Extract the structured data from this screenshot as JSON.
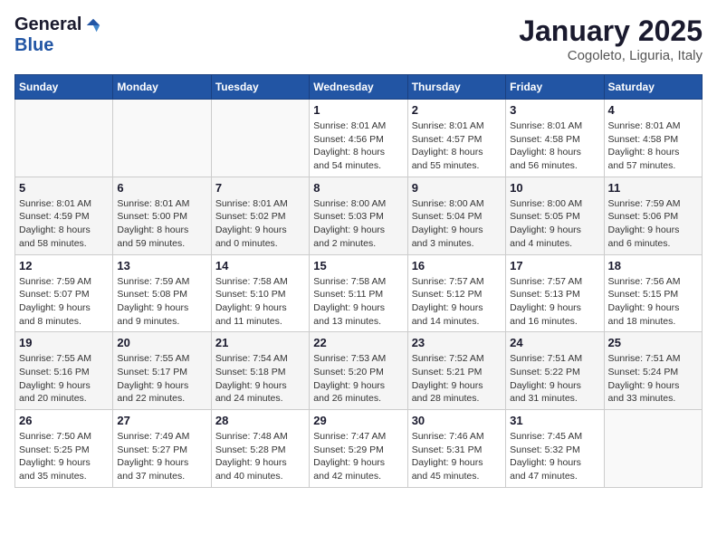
{
  "logo": {
    "general": "General",
    "blue": "Blue"
  },
  "header": {
    "month": "January 2025",
    "location": "Cogoleto, Liguria, Italy"
  },
  "weekdays": [
    "Sunday",
    "Monday",
    "Tuesday",
    "Wednesday",
    "Thursday",
    "Friday",
    "Saturday"
  ],
  "weeks": [
    [
      {
        "day": "",
        "info": ""
      },
      {
        "day": "",
        "info": ""
      },
      {
        "day": "",
        "info": ""
      },
      {
        "day": "1",
        "info": "Sunrise: 8:01 AM\nSunset: 4:56 PM\nDaylight: 8 hours\nand 54 minutes."
      },
      {
        "day": "2",
        "info": "Sunrise: 8:01 AM\nSunset: 4:57 PM\nDaylight: 8 hours\nand 55 minutes."
      },
      {
        "day": "3",
        "info": "Sunrise: 8:01 AM\nSunset: 4:58 PM\nDaylight: 8 hours\nand 56 minutes."
      },
      {
        "day": "4",
        "info": "Sunrise: 8:01 AM\nSunset: 4:58 PM\nDaylight: 8 hours\nand 57 minutes."
      }
    ],
    [
      {
        "day": "5",
        "info": "Sunrise: 8:01 AM\nSunset: 4:59 PM\nDaylight: 8 hours\nand 58 minutes."
      },
      {
        "day": "6",
        "info": "Sunrise: 8:01 AM\nSunset: 5:00 PM\nDaylight: 8 hours\nand 59 minutes."
      },
      {
        "day": "7",
        "info": "Sunrise: 8:01 AM\nSunset: 5:02 PM\nDaylight: 9 hours\nand 0 minutes."
      },
      {
        "day": "8",
        "info": "Sunrise: 8:00 AM\nSunset: 5:03 PM\nDaylight: 9 hours\nand 2 minutes."
      },
      {
        "day": "9",
        "info": "Sunrise: 8:00 AM\nSunset: 5:04 PM\nDaylight: 9 hours\nand 3 minutes."
      },
      {
        "day": "10",
        "info": "Sunrise: 8:00 AM\nSunset: 5:05 PM\nDaylight: 9 hours\nand 4 minutes."
      },
      {
        "day": "11",
        "info": "Sunrise: 7:59 AM\nSunset: 5:06 PM\nDaylight: 9 hours\nand 6 minutes."
      }
    ],
    [
      {
        "day": "12",
        "info": "Sunrise: 7:59 AM\nSunset: 5:07 PM\nDaylight: 9 hours\nand 8 minutes."
      },
      {
        "day": "13",
        "info": "Sunrise: 7:59 AM\nSunset: 5:08 PM\nDaylight: 9 hours\nand 9 minutes."
      },
      {
        "day": "14",
        "info": "Sunrise: 7:58 AM\nSunset: 5:10 PM\nDaylight: 9 hours\nand 11 minutes."
      },
      {
        "day": "15",
        "info": "Sunrise: 7:58 AM\nSunset: 5:11 PM\nDaylight: 9 hours\nand 13 minutes."
      },
      {
        "day": "16",
        "info": "Sunrise: 7:57 AM\nSunset: 5:12 PM\nDaylight: 9 hours\nand 14 minutes."
      },
      {
        "day": "17",
        "info": "Sunrise: 7:57 AM\nSunset: 5:13 PM\nDaylight: 9 hours\nand 16 minutes."
      },
      {
        "day": "18",
        "info": "Sunrise: 7:56 AM\nSunset: 5:15 PM\nDaylight: 9 hours\nand 18 minutes."
      }
    ],
    [
      {
        "day": "19",
        "info": "Sunrise: 7:55 AM\nSunset: 5:16 PM\nDaylight: 9 hours\nand 20 minutes."
      },
      {
        "day": "20",
        "info": "Sunrise: 7:55 AM\nSunset: 5:17 PM\nDaylight: 9 hours\nand 22 minutes."
      },
      {
        "day": "21",
        "info": "Sunrise: 7:54 AM\nSunset: 5:18 PM\nDaylight: 9 hours\nand 24 minutes."
      },
      {
        "day": "22",
        "info": "Sunrise: 7:53 AM\nSunset: 5:20 PM\nDaylight: 9 hours\nand 26 minutes."
      },
      {
        "day": "23",
        "info": "Sunrise: 7:52 AM\nSunset: 5:21 PM\nDaylight: 9 hours\nand 28 minutes."
      },
      {
        "day": "24",
        "info": "Sunrise: 7:51 AM\nSunset: 5:22 PM\nDaylight: 9 hours\nand 31 minutes."
      },
      {
        "day": "25",
        "info": "Sunrise: 7:51 AM\nSunset: 5:24 PM\nDaylight: 9 hours\nand 33 minutes."
      }
    ],
    [
      {
        "day": "26",
        "info": "Sunrise: 7:50 AM\nSunset: 5:25 PM\nDaylight: 9 hours\nand 35 minutes."
      },
      {
        "day": "27",
        "info": "Sunrise: 7:49 AM\nSunset: 5:27 PM\nDaylight: 9 hours\nand 37 minutes."
      },
      {
        "day": "28",
        "info": "Sunrise: 7:48 AM\nSunset: 5:28 PM\nDaylight: 9 hours\nand 40 minutes."
      },
      {
        "day": "29",
        "info": "Sunrise: 7:47 AM\nSunset: 5:29 PM\nDaylight: 9 hours\nand 42 minutes."
      },
      {
        "day": "30",
        "info": "Sunrise: 7:46 AM\nSunset: 5:31 PM\nDaylight: 9 hours\nand 45 minutes."
      },
      {
        "day": "31",
        "info": "Sunrise: 7:45 AM\nSunset: 5:32 PM\nDaylight: 9 hours\nand 47 minutes."
      },
      {
        "day": "",
        "info": ""
      }
    ]
  ]
}
